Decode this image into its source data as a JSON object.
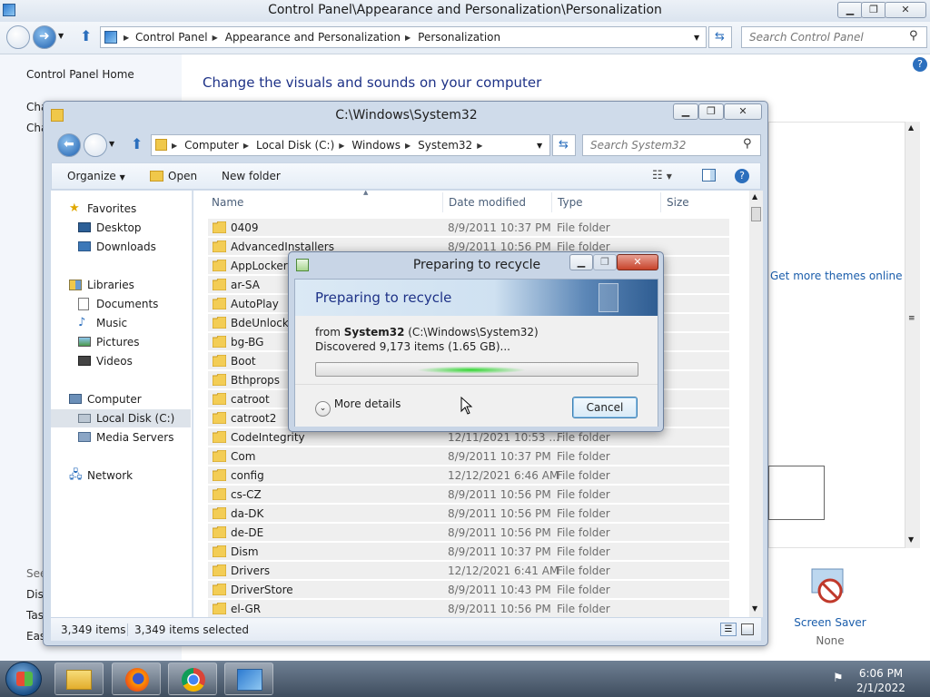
{
  "control_panel": {
    "title": "Control Panel\\Appearance and Personalization\\Personalization",
    "breadcrumbs": [
      "Control Panel",
      "Appearance and Personalization",
      "Personalization"
    ],
    "search_placeholder": "Search Control Panel",
    "left": {
      "home": "Control Panel Home",
      "partial_1": "Cha",
      "partial_2": "Cha",
      "see_also": "See",
      "display": "Disp",
      "taskbar": "Tas",
      "ease": "Eas"
    },
    "heading": "Change the visuals and sounds on your computer",
    "themes_link": "Get more themes online",
    "screen_saver": {
      "label": "Screen Saver",
      "value": "None"
    }
  },
  "explorer": {
    "title": "C:\\Windows\\System32",
    "breadcrumbs": [
      "Computer",
      "Local Disk (C:)",
      "Windows",
      "System32"
    ],
    "search_placeholder": "Search System32",
    "toolbar": {
      "organize": "Organize",
      "open": "Open",
      "new_folder": "New folder"
    },
    "nav": {
      "favorites": "Favorites",
      "desktop": "Desktop",
      "downloads": "Downloads",
      "libraries": "Libraries",
      "documents": "Documents",
      "music": "Music",
      "pictures": "Pictures",
      "videos": "Videos",
      "computer": "Computer",
      "local_disk": "Local Disk (C:)",
      "media_servers": "Media Servers",
      "network": "Network"
    },
    "columns": {
      "name": "Name",
      "date": "Date modified",
      "type": "Type",
      "size": "Size"
    },
    "rows": [
      {
        "name": "0409",
        "date": "8/9/2011 10:37 PM",
        "type": "File folder"
      },
      {
        "name": "AdvancedInstallers",
        "date": "8/9/2011 10:56 PM",
        "type": "File folder"
      },
      {
        "name": "AppLocker",
        "date": "",
        "type": ""
      },
      {
        "name": "ar-SA",
        "date": "",
        "type": ""
      },
      {
        "name": "AutoPlay",
        "date": "",
        "type": ""
      },
      {
        "name": "BdeUnlock",
        "date": "",
        "type": ""
      },
      {
        "name": "bg-BG",
        "date": "",
        "type": ""
      },
      {
        "name": "Boot",
        "date": "",
        "type": ""
      },
      {
        "name": "Bthprops",
        "date": "",
        "type": ""
      },
      {
        "name": "catroot",
        "date": "",
        "type": ""
      },
      {
        "name": "catroot2",
        "date": "",
        "type": ""
      },
      {
        "name": "CodeIntegrity",
        "date": "12/11/2021 10:53 ...",
        "type": "File folder"
      },
      {
        "name": "Com",
        "date": "8/9/2011 10:37 PM",
        "type": "File folder"
      },
      {
        "name": "config",
        "date": "12/12/2021 6:46 AM",
        "type": "File folder"
      },
      {
        "name": "cs-CZ",
        "date": "8/9/2011 10:56 PM",
        "type": "File folder"
      },
      {
        "name": "da-DK",
        "date": "8/9/2011 10:56 PM",
        "type": "File folder"
      },
      {
        "name": "de-DE",
        "date": "8/9/2011 10:56 PM",
        "type": "File folder"
      },
      {
        "name": "Dism",
        "date": "8/9/2011 10:37 PM",
        "type": "File folder"
      },
      {
        "name": "Drivers",
        "date": "12/12/2021 6:41 AM",
        "type": "File folder"
      },
      {
        "name": "DriverStore",
        "date": "8/9/2011 10:43 PM",
        "type": "File folder"
      },
      {
        "name": "el-GR",
        "date": "8/9/2011 10:56 PM",
        "type": "File folder"
      }
    ],
    "status": {
      "count": "3,349 items",
      "selected": "3,349 items selected"
    }
  },
  "dialog": {
    "title": "Preparing to recycle",
    "heading": "Preparing to recycle",
    "from_prefix": "from ",
    "from_name": "System32",
    "from_path": " (C:\\Windows\\System32)",
    "discovered": "Discovered 9,173 items (1.65 GB)...",
    "more_details": "More details",
    "cancel": "Cancel"
  },
  "taskbar": {
    "time": "6:06 PM",
    "date": "2/1/2022"
  }
}
